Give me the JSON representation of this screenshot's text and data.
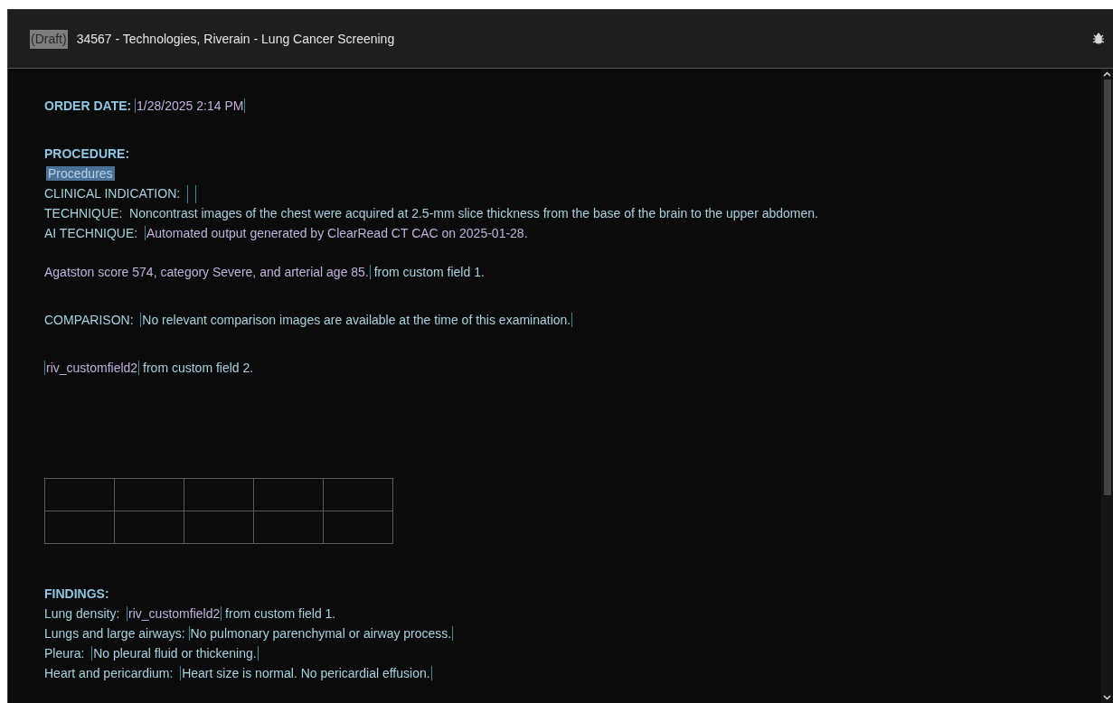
{
  "window": {
    "status_badge": "(Draft)",
    "title": "34567 - Technologies, Riverain - Lung Cancer Screening"
  },
  "report": {
    "lines": [
      {
        "kind": "text",
        "segments": [
          {
            "kind": "heading",
            "text": "ORDER DATE: "
          },
          {
            "kind": "autofield",
            "text": "1/28/2025 2:14 PM"
          }
        ]
      },
      {
        "kind": "blank"
      },
      {
        "kind": "text",
        "segments": [
          {
            "kind": "heading",
            "text": "PROCEDURE:"
          }
        ]
      },
      {
        "kind": "text",
        "segments": [
          {
            "kind": "selection",
            "text": "Procedures"
          }
        ]
      },
      {
        "kind": "text",
        "segments": [
          {
            "kind": "label",
            "text": "CLINICAL INDICATION:  "
          },
          {
            "kind": "empty_field"
          }
        ]
      },
      {
        "kind": "text",
        "segments": [
          {
            "kind": "label",
            "text": "TECHNIQUE:  Noncontrast images of the chest were acquired at 2.5-mm slice thickness from the base of the brain to the upper abdomen."
          }
        ]
      },
      {
        "kind": "text",
        "segments": [
          {
            "kind": "label",
            "text": "AI TECHNIQUE:  "
          },
          {
            "kind": "autofield_start",
            "text": "Automated output generated by ClearRead CT CAC on 2025-01-28."
          }
        ]
      },
      {
        "kind": "break"
      },
      {
        "kind": "text",
        "segments": [
          {
            "kind": "autofield_end",
            "text": "Agatston score 574, category Severe, and arterial age 85."
          },
          {
            "kind": "label",
            "text": " from custom field 1."
          }
        ]
      },
      {
        "kind": "blank"
      },
      {
        "kind": "text",
        "segments": [
          {
            "kind": "label",
            "text": "COMPARISON:  "
          },
          {
            "kind": "field",
            "text": "No relevant comparison images are available at the time of this examination."
          }
        ]
      },
      {
        "kind": "blank"
      },
      {
        "kind": "text",
        "segments": [
          {
            "kind": "autofield",
            "text": "riv_customfield2"
          },
          {
            "kind": "label",
            "text": " from custom field 2."
          }
        ]
      },
      {
        "kind": "blank"
      },
      {
        "kind": "blank"
      },
      {
        "kind": "blank"
      },
      {
        "kind": "table"
      },
      {
        "kind": "blank"
      },
      {
        "kind": "text",
        "segments": [
          {
            "kind": "heading",
            "text": "FINDINGS:"
          }
        ]
      },
      {
        "kind": "text",
        "segments": [
          {
            "kind": "label",
            "text": "Lung density:  "
          },
          {
            "kind": "autofield",
            "text": "riv_customfield2"
          },
          {
            "kind": "label",
            "text": " from custom field 1."
          }
        ]
      },
      {
        "kind": "text",
        "segments": [
          {
            "kind": "label",
            "text": "Lungs and large airways: "
          },
          {
            "kind": "field",
            "text": "No pulmonary parenchymal or airway process."
          }
        ]
      },
      {
        "kind": "text",
        "segments": [
          {
            "kind": "label",
            "text": "Pleura:  "
          },
          {
            "kind": "field",
            "text": "No pleural fluid or thickening."
          }
        ]
      },
      {
        "kind": "text",
        "segments": [
          {
            "kind": "label",
            "text": "Heart and pericardium:  "
          },
          {
            "kind": "field",
            "text": "Heart size is normal. No pericardial effusion."
          }
        ]
      }
    ]
  }
}
